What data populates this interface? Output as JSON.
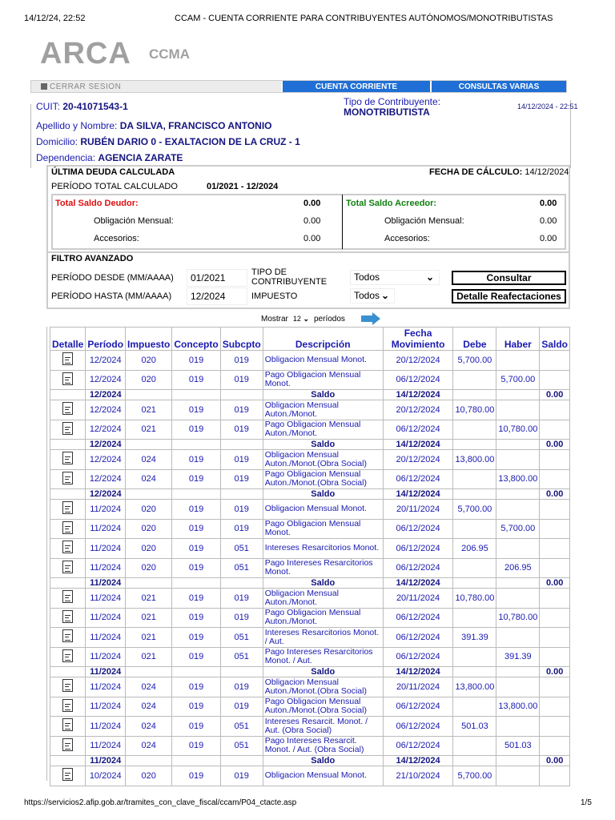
{
  "print_header": {
    "datetime": "14/12/24, 22:52",
    "title": "CCAM - CUENTA CORRIENTE PARA CONTRIBUYENTES AUTÓNOMOS/MONOTRIBUTISTAS"
  },
  "logo": {
    "brand": "ARCA",
    "app": "CCMA"
  },
  "nav": {
    "logout": "CERRAR SESION",
    "tabs": [
      "CUENTA CORRIENTE",
      "CONSULTAS VARIAS"
    ],
    "accent": "#1f6fd6"
  },
  "taxpayer": {
    "cuit_label": "CUIT:",
    "cuit": "20-41071543-1",
    "tipo_label": "Tipo de Contribuyente:",
    "tipo": "MONOTRIBUTISTA",
    "datetime": "14/12/2024 - 22:51",
    "nombre_label": "Apellido y Nombre:",
    "nombre": "DA SILVA, FRANCISCO ANTONIO",
    "domicilio_label": "Domicilio:",
    "domicilio": "RUBÉN DARIO 0 - EXALTACION DE LA CRUZ - 1",
    "dependencia_label": "Dependencia:",
    "dependencia": "AGENCIA ZARATE"
  },
  "deuda": {
    "title": "ÚLTIMA DEUDA CALCULADA",
    "fecha_label": "FECHA DE CÁLCULO:",
    "fecha": "14/12/2024",
    "periodo_label": "PERÍODO TOTAL CALCULADO",
    "periodo": "01/2021 - 12/2024",
    "deudor": {
      "label": "Total Saldo Deudor:",
      "total": "0.00",
      "oblig_label": "Obligación Mensual:",
      "oblig": "0.00",
      "acc_label": "Accesorios:",
      "acc": "0.00"
    },
    "acreedor": {
      "label": "Total Saldo Acreedor:",
      "total": "0.00",
      "oblig_label": "Obligación Mensual:",
      "oblig": "0.00",
      "acc_label": "Accesorios:",
      "acc": "0.00"
    }
  },
  "filtro": {
    "title": "FILTRO AVANZADO",
    "desde_label": "PERÍODO DESDE (MM/AAAA)",
    "desde": "01/2021",
    "hasta_label": "PERÍODO HASTA (MM/AAAA)",
    "hasta": "12/2024",
    "tipo_label": "TIPO DE CONTRIBUYENTE",
    "tipo": "Todos",
    "impuesto_label": "IMPUESTO",
    "impuesto": "Todos",
    "consultar": "Consultar",
    "detalle": "Detalle Reafectaciones"
  },
  "paging": {
    "mostrar": "Mostrar",
    "count": "12",
    "periodos": "períodos"
  },
  "table": {
    "headers": [
      "Detalle",
      "Período",
      "Impuesto",
      "Concepto",
      "Subcpto",
      "Descripción",
      "Fecha Movimiento",
      "Debe",
      "Haber",
      "Saldo"
    ],
    "rows": [
      {
        "t": "n",
        "c": [
          "12/2024",
          "020",
          "019",
          "019",
          "Obligacion Mensual Monot.",
          "20/12/2024",
          "5,700.00",
          "",
          ""
        ]
      },
      {
        "t": "n",
        "c": [
          "12/2024",
          "020",
          "019",
          "019",
          "Pago Obligacion Mensual Monot.",
          "06/12/2024",
          "",
          "5,700.00",
          ""
        ]
      },
      {
        "t": "s",
        "c": [
          "12/2024",
          "",
          "",
          "",
          "Saldo",
          "14/12/2024",
          "",
          "",
          "0.00"
        ]
      },
      {
        "t": "n",
        "c": [
          "12/2024",
          "021",
          "019",
          "019",
          "Obligacion Mensual Auton./Monot.",
          "20/12/2024",
          "10,780.00",
          "",
          ""
        ]
      },
      {
        "t": "n",
        "c": [
          "12/2024",
          "021",
          "019",
          "019",
          "Pago Obligacion Mensual Auton./Monot.",
          "06/12/2024",
          "",
          "10,780.00",
          ""
        ]
      },
      {
        "t": "s",
        "c": [
          "12/2024",
          "",
          "",
          "",
          "Saldo",
          "14/12/2024",
          "",
          "",
          "0.00"
        ]
      },
      {
        "t": "n",
        "c": [
          "12/2024",
          "024",
          "019",
          "019",
          "Obligacion Mensual Auton./Monot.(Obra Social)",
          "20/12/2024",
          "13,800.00",
          "",
          ""
        ]
      },
      {
        "t": "n",
        "c": [
          "12/2024",
          "024",
          "019",
          "019",
          "Pago Obligacion Mensual Auton./Monot.(Obra Social)",
          "06/12/2024",
          "",
          "13,800.00",
          ""
        ]
      },
      {
        "t": "s",
        "c": [
          "12/2024",
          "",
          "",
          "",
          "Saldo",
          "14/12/2024",
          "",
          "",
          "0.00"
        ]
      },
      {
        "t": "n",
        "c": [
          "11/2024",
          "020",
          "019",
          "019",
          "Obligacion Mensual Monot.",
          "20/11/2024",
          "5,700.00",
          "",
          ""
        ]
      },
      {
        "t": "n",
        "c": [
          "11/2024",
          "020",
          "019",
          "019",
          "Pago Obligacion Mensual Monot.",
          "06/12/2024",
          "",
          "5,700.00",
          ""
        ]
      },
      {
        "t": "n",
        "c": [
          "11/2024",
          "020",
          "019",
          "051",
          "Intereses Resarcitorios Monot.",
          "06/12/2024",
          "206.95",
          "",
          ""
        ]
      },
      {
        "t": "n",
        "c": [
          "11/2024",
          "020",
          "019",
          "051",
          "Pago Intereses Resarcitorios Monot.",
          "06/12/2024",
          "",
          "206.95",
          ""
        ]
      },
      {
        "t": "s",
        "c": [
          "11/2024",
          "",
          "",
          "",
          "Saldo",
          "14/12/2024",
          "",
          "",
          "0.00"
        ]
      },
      {
        "t": "n",
        "c": [
          "11/2024",
          "021",
          "019",
          "019",
          "Obligacion Mensual Auton./Monot.",
          "20/11/2024",
          "10,780.00",
          "",
          ""
        ]
      },
      {
        "t": "n",
        "c": [
          "11/2024",
          "021",
          "019",
          "019",
          "Pago Obligacion Mensual Auton./Monot.",
          "06/12/2024",
          "",
          "10,780.00",
          ""
        ]
      },
      {
        "t": "n",
        "c": [
          "11/2024",
          "021",
          "019",
          "051",
          "Intereses Resarcitorios Monot. / Aut.",
          "06/12/2024",
          "391.39",
          "",
          ""
        ]
      },
      {
        "t": "n",
        "c": [
          "11/2024",
          "021",
          "019",
          "051",
          "Pago Intereses Resarcitorios Monot. / Aut.",
          "06/12/2024",
          "",
          "391.39",
          ""
        ]
      },
      {
        "t": "s",
        "c": [
          "11/2024",
          "",
          "",
          "",
          "Saldo",
          "14/12/2024",
          "",
          "",
          "0.00"
        ]
      },
      {
        "t": "n",
        "c": [
          "11/2024",
          "024",
          "019",
          "019",
          "Obligacion Mensual Auton./Monot.(Obra Social)",
          "20/11/2024",
          "13,800.00",
          "",
          ""
        ]
      },
      {
        "t": "n",
        "c": [
          "11/2024",
          "024",
          "019",
          "019",
          "Pago Obligacion Mensual Auton./Monot.(Obra Social)",
          "06/12/2024",
          "",
          "13,800.00",
          ""
        ]
      },
      {
        "t": "n",
        "c": [
          "11/2024",
          "024",
          "019",
          "051",
          "Intereses Resarcit. Monot. / Aut. (Obra Social)",
          "06/12/2024",
          "501.03",
          "",
          ""
        ]
      },
      {
        "t": "n",
        "c": [
          "11/2024",
          "024",
          "019",
          "051",
          "Pago Intereses Resarcit. Monot. / Aut. (Obra Social)",
          "06/12/2024",
          "",
          "501.03",
          ""
        ]
      },
      {
        "t": "s",
        "c": [
          "11/2024",
          "",
          "",
          "",
          "Saldo",
          "14/12/2024",
          "",
          "",
          "0.00"
        ]
      },
      {
        "t": "n",
        "c": [
          "10/2024",
          "020",
          "019",
          "019",
          "Obligacion Mensual Monot.",
          "21/10/2024",
          "5,700.00",
          "",
          ""
        ]
      }
    ]
  },
  "footer": {
    "url": "https://servicios2.afip.gob.ar/tramites_con_clave_fiscal/ccam/P04_ctacte.asp",
    "page": "1/5"
  }
}
